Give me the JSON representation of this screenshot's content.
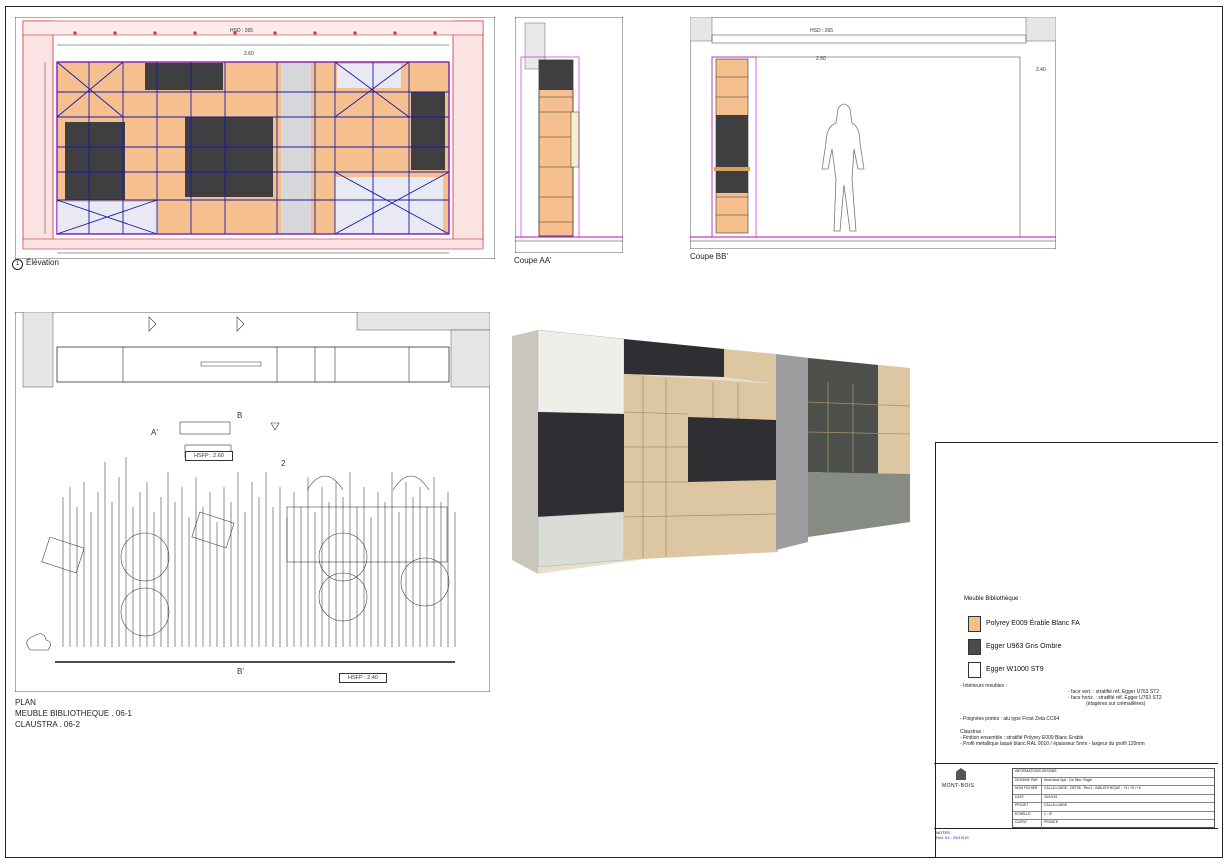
{
  "drawings": {
    "elevation": {
      "caption_num": "1",
      "caption": "Élévation",
      "hsd": "HSD : 265",
      "dim_top": "2.60",
      "dim_right": "2.40"
    },
    "coupe_aa": {
      "caption": "Coupe AA'"
    },
    "coupe_bb": {
      "caption": "Coupe BB'",
      "hsd": "HSD : 265",
      "dim": "2.60",
      "dim_right": "2.40"
    },
    "plan": {
      "title": "PLAN",
      "lines": [
        "MEUBLE BIBLIOTHEQUE  .  06-1",
        "CLAUSTRA  .  06-2"
      ],
      "hsfp_top": "HSFP : 2.60",
      "hsfp_bottom": "HSFP : 2.40",
      "marker_a": "A'",
      "marker_b": "B",
      "marker_b2": "B'",
      "marker_2": "2"
    }
  },
  "legend": {
    "title": "Meuble Bibliothèque :",
    "items": [
      {
        "label": "Polyrey E009 Érable Blanc FA",
        "color": "#f6c08e"
      },
      {
        "label": "Egger U963 Gris Ombre",
        "color": "#4a4a4c"
      },
      {
        "label": "Egger W1000 ST9",
        "color": "#ffffff"
      }
    ],
    "interieurs_title": "- Intérieurs meubles :",
    "interieurs": [
      "- face vert. : stratifié réf. Egger U763 ST2",
      "- face horiz. : stratifié réf. Egger U763 ST2",
      "(étagères sur crémaillères)"
    ],
    "poignees": "- Poignées portes : alu type Frost Zeta CC64",
    "claustras_title": "Claustras :",
    "claustras": [
      "- Finition ensemble : stratifié Polyrey E009 Blanc Erable",
      "- Profil métallique laqué blanc RAL 9010  /  épaisseur 5mm  -  largeur du profil 120mm"
    ]
  },
  "titleblock": {
    "brand": "MONT-BOIS",
    "header": "INFORMATIONS DESSINS",
    "rows": [
      {
        "k": "DESSINE PAR",
        "v": "Mont-Bois Sprl - De Sibo, Roger"
      },
      {
        "k": "NOM FICHIER",
        "v": "CALLA LUNGE - DET06 - Rev.1 - BIBLIOTHEQUE - +4 / +5 / +6"
      },
      {
        "k": "DATE",
        "v": "20/10/19"
      },
      {
        "k": "PROJET",
        "v": "CALLA LUNGE"
      },
      {
        "k": "ECHELLE",
        "v": "1 : 20"
      },
      {
        "k": "CLIENT",
        "v": "PRIVATE"
      }
    ]
  },
  "revision": {
    "label": "NOTES",
    "value": "Rev. 01 - 29/10/19"
  }
}
